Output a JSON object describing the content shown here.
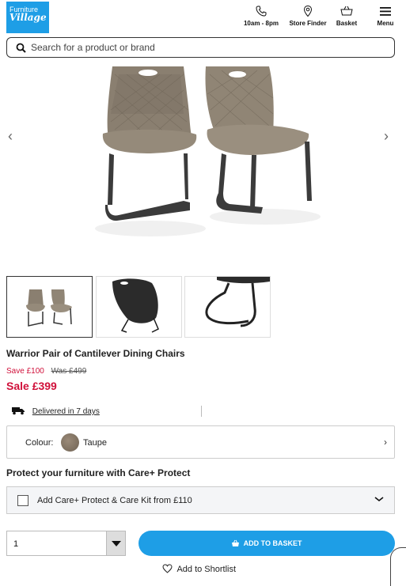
{
  "header": {
    "logo_line1": "Furniture",
    "logo_line2": "Village",
    "hours_label": "10am - 8pm",
    "store_finder_label": "Store Finder",
    "basket_label": "Basket",
    "menu_label": "Menu"
  },
  "search": {
    "placeholder": "Search for a product or brand",
    "value": ""
  },
  "gallery": {
    "prev": "‹",
    "next": "›",
    "thumbnail_count": 3,
    "active_thumbnail": 1
  },
  "product": {
    "title": "Warrior Pair of Cantilever Dining Chairs",
    "save_text": "Save £100",
    "was_text": "Was £499",
    "sale_text": "Sale £399",
    "delivery_text": "Delivered in 7 days"
  },
  "colour": {
    "label": "Colour:",
    "name": "Taupe",
    "swatch_color": "#85776a",
    "chevron": "›"
  },
  "care": {
    "title": "Protect your furniture with Care+ Protect",
    "option_label": "Add Care+ Protect & Care Kit from £110",
    "checked": false
  },
  "purchase": {
    "quantity": "1",
    "add_to_basket": "ADD TO BASKET",
    "shortlist": "Add to Shortlist"
  },
  "colors": {
    "brand_blue": "#1e9ee6",
    "sale_red": "#d0103a"
  }
}
